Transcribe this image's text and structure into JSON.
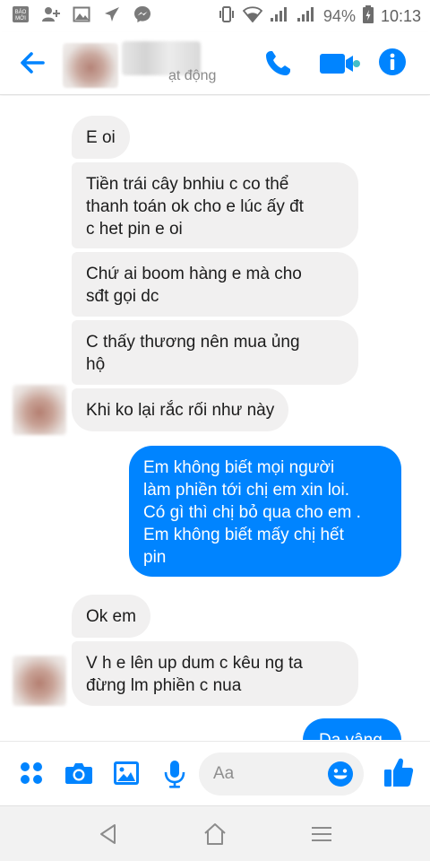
{
  "status_bar": {
    "left_icons": [
      "bao-moi-icon",
      "add-person-icon",
      "gallery-icon",
      "airplane-icon",
      "messenger-icon"
    ],
    "battery": "94%",
    "time": "10:13"
  },
  "header": {
    "status_suffix": "ạt động",
    "icons": [
      "back-arrow-icon",
      "phone-icon",
      "video-icon",
      "info-icon"
    ]
  },
  "messages": [
    {
      "side": "in",
      "text": "E oi"
    },
    {
      "side": "in",
      "lines": [
        "Tiền trái cây bnhiu c co thể",
        "thanh toán ok cho e lúc ấy đt",
        "c het pin e oi"
      ]
    },
    {
      "side": "in",
      "lines": [
        "Chứ ai boom hàng e mà cho",
        "sđt gọi dc"
      ]
    },
    {
      "side": "in",
      "lines": [
        "C thấy thương nên mua ủng",
        "hộ"
      ]
    },
    {
      "side": "in",
      "text": "Khi ko lại rắc rối như này"
    },
    {
      "side": "out",
      "lines": [
        "Em không biết mọi người",
        "làm phiền tới chị em xin loi.",
        "Có gì thì chị bỏ qua cho em .",
        "Em không biết mấy chị hết",
        "pin"
      ]
    },
    {
      "side": "in",
      "text": "Ok em"
    },
    {
      "side": "in",
      "lines": [
        "V h e lên up dum c kêu ng ta",
        "đừng lm phiền c nua"
      ]
    },
    {
      "side": "out",
      "text": "Da vâng"
    }
  ],
  "composer": {
    "placeholder": "Aa",
    "icons": [
      "apps-grid-icon",
      "camera-icon",
      "image-icon",
      "microphone-icon",
      "emoji-icon",
      "thumbs-up-icon"
    ]
  },
  "nav_bar": {
    "icons": [
      "back-triangle-icon",
      "home-icon",
      "menu-icon"
    ]
  },
  "colors": {
    "accent": "#0084ff",
    "incoming_bubble": "#f1f0f0",
    "outgoing_bubble": "#0084ff"
  }
}
